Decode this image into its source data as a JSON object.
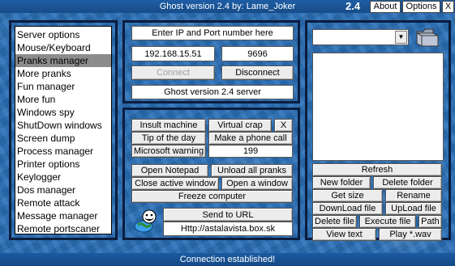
{
  "window": {
    "title": "Ghost version 2.4 by: Lame_Joker",
    "version": "2.4",
    "about_label": "About",
    "options_label": "Options",
    "close_label": "X"
  },
  "menu": {
    "items": [
      "Server options",
      "Mouse/Keyboard",
      "Pranks manager",
      "More pranks",
      "Fun manager",
      "More fun",
      "Windows spy",
      "ShutDown windows",
      "Screen dump",
      "Process manager",
      "Printer options",
      "Keylogger",
      "Dos manager",
      "Remote attack",
      "Message manager",
      "Remote portscaner"
    ],
    "selected": "Pranks manager"
  },
  "connection": {
    "header": "Enter IP and Port number here",
    "ip": "192.168.15.51",
    "port": "9696",
    "connect_label": "Connect",
    "disconnect_label": "Disconnect",
    "server_label": "Ghost version 2.4 server"
  },
  "pranks": {
    "insult": "Insult machine",
    "virtual_crap": "Virtual crap",
    "x": "X",
    "tip": "Tip of the day",
    "phone": "Make a phone call",
    "warning": "Microsoft warning",
    "warning_value": "199",
    "open_notepad": "Open Notepad",
    "unload_pranks": "Unload all pranks",
    "close_window": "Close active window",
    "open_window": "Open a window",
    "freeze": "Freeze computer",
    "send_url": "Send to URL",
    "url_value": "Http://astalavista.box.sk"
  },
  "files": {
    "refresh": "Refresh",
    "new_folder": "New folder",
    "delete_folder": "Delete folder",
    "get_size": "Get size",
    "rename": "Rename",
    "download": "DownLoad file",
    "upload": "UpLoad file",
    "delete_file": "Delete file",
    "execute": "Execute file",
    "path": "Path",
    "view_text": "View text",
    "play_wav": "Play *.wav"
  },
  "status": {
    "text": "Connection established!"
  },
  "colors": {
    "background": "#2a6fb7",
    "panel_border": "#0b1d3e",
    "selected_item": "#8c8c8c"
  },
  "icons": {
    "combo_arrow": "chevron-down-icon",
    "folder": "folder-icon",
    "globe": "globe-smiley-icon"
  }
}
